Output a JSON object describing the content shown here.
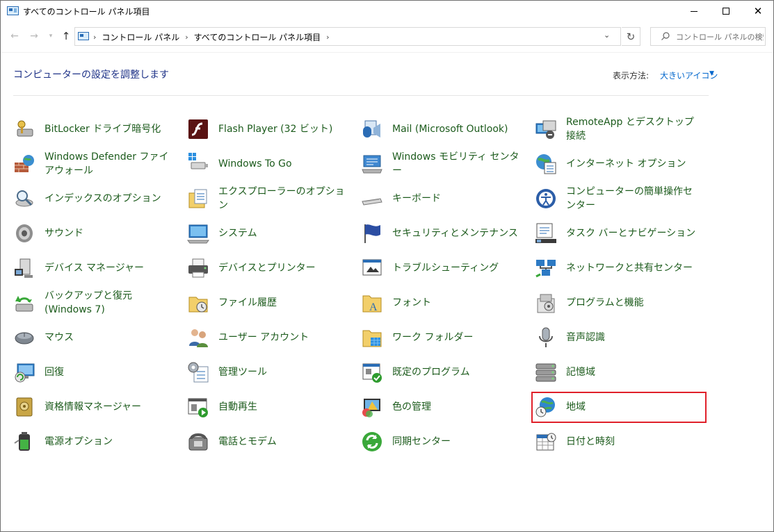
{
  "window": {
    "title": "すべてのコントロール パネル項目"
  },
  "address": {
    "crumbs": [
      "コントロール パネル",
      "すべてのコントロール パネル項目"
    ],
    "search_placeholder": "コントロール パネルの検索"
  },
  "header": {
    "heading": "コンピューターの設定を調整します",
    "view_label": "表示方法:",
    "view_value": "大きいアイコン"
  },
  "columns": [
    {
      "items": [
        {
          "label": "BitLocker ドライブ暗号化",
          "icon": "key-drive-icon"
        },
        {
          "label": "Windows Defender ファイアウォール",
          "icon": "firewall-icon"
        },
        {
          "label": "インデックスのオプション",
          "icon": "indexing-icon"
        },
        {
          "label": "サウンド",
          "icon": "speaker-icon"
        },
        {
          "label": "デバイス マネージャー",
          "icon": "device-manager-icon"
        },
        {
          "label": "バックアップと復元 (Windows 7)",
          "icon": "backup-icon"
        },
        {
          "label": "マウス",
          "icon": "mouse-icon"
        },
        {
          "label": "回復",
          "icon": "recovery-icon"
        },
        {
          "label": "資格情報マネージャー",
          "icon": "credential-vault-icon"
        },
        {
          "label": "電源オプション",
          "icon": "battery-icon"
        }
      ]
    },
    {
      "items": [
        {
          "label": "Flash Player (32 ビット)",
          "icon": "flash-icon"
        },
        {
          "label": "Windows To Go",
          "icon": "usb-drive-icon"
        },
        {
          "label": "エクスプローラーのオプション",
          "icon": "folder-options-icon"
        },
        {
          "label": "システム",
          "icon": "computer-icon"
        },
        {
          "label": "デバイスとプリンター",
          "icon": "printer-icon"
        },
        {
          "label": "ファイル履歴",
          "icon": "file-history-icon"
        },
        {
          "label": "ユーザー アカウント",
          "icon": "users-icon"
        },
        {
          "label": "管理ツール",
          "icon": "admin-tools-icon"
        },
        {
          "label": "自動再生",
          "icon": "autoplay-icon"
        },
        {
          "label": "電話とモデム",
          "icon": "phone-icon"
        }
      ]
    },
    {
      "items": [
        {
          "label": "Mail (Microsoft Outlook)",
          "icon": "mail-icon"
        },
        {
          "label": "Windows モビリティ センター",
          "icon": "mobility-icon"
        },
        {
          "label": "キーボード",
          "icon": "keyboard-icon"
        },
        {
          "label": "セキュリティとメンテナンス",
          "icon": "flag-icon"
        },
        {
          "label": "トラブルシューティング",
          "icon": "troubleshoot-icon"
        },
        {
          "label": "フォント",
          "icon": "fonts-icon"
        },
        {
          "label": "ワーク フォルダー",
          "icon": "work-folders-icon"
        },
        {
          "label": "既定のプログラム",
          "icon": "default-programs-icon"
        },
        {
          "label": "色の管理",
          "icon": "color-management-icon"
        },
        {
          "label": "同期センター",
          "icon": "sync-icon"
        }
      ]
    },
    {
      "items": [
        {
          "label": "RemoteApp とデスクトップ接続",
          "icon": "remote-desktop-icon"
        },
        {
          "label": "インターネット オプション",
          "icon": "internet-options-icon"
        },
        {
          "label": "コンピューターの簡単操作センター",
          "icon": "ease-of-access-icon"
        },
        {
          "label": "タスク バーとナビゲーション",
          "icon": "taskbar-icon"
        },
        {
          "label": "ネットワークと共有センター",
          "icon": "network-icon"
        },
        {
          "label": "プログラムと機能",
          "icon": "programs-icon"
        },
        {
          "label": "音声認識",
          "icon": "microphone-icon"
        },
        {
          "label": "記憶域",
          "icon": "storage-icon"
        },
        {
          "label": "地域",
          "icon": "region-globe-icon"
        },
        {
          "label": "日付と時刻",
          "icon": "calendar-clock-icon"
        }
      ]
    }
  ],
  "colors": {
    "link_green": "#1c5b1c",
    "heading_blue": "#1e3287",
    "highlight_red": "#e0202a"
  }
}
